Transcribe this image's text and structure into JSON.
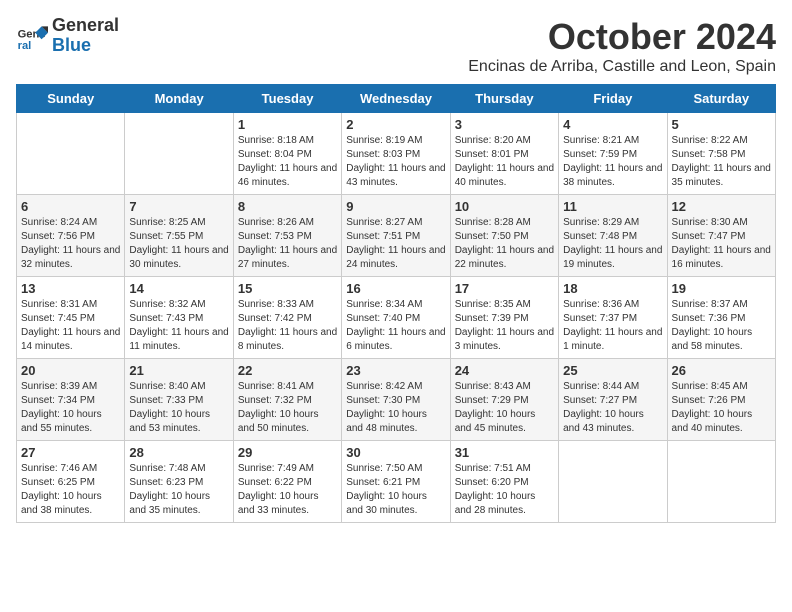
{
  "header": {
    "logo_line1": "General",
    "logo_line2": "Blue",
    "month": "October 2024",
    "location": "Encinas de Arriba, Castille and Leon, Spain"
  },
  "weekdays": [
    "Sunday",
    "Monday",
    "Tuesday",
    "Wednesday",
    "Thursday",
    "Friday",
    "Saturday"
  ],
  "weeks": [
    [
      {
        "day": "",
        "info": ""
      },
      {
        "day": "",
        "info": ""
      },
      {
        "day": "1",
        "info": "Sunrise: 8:18 AM\nSunset: 8:04 PM\nDaylight: 11 hours and 46 minutes."
      },
      {
        "day": "2",
        "info": "Sunrise: 8:19 AM\nSunset: 8:03 PM\nDaylight: 11 hours and 43 minutes."
      },
      {
        "day": "3",
        "info": "Sunrise: 8:20 AM\nSunset: 8:01 PM\nDaylight: 11 hours and 40 minutes."
      },
      {
        "day": "4",
        "info": "Sunrise: 8:21 AM\nSunset: 7:59 PM\nDaylight: 11 hours and 38 minutes."
      },
      {
        "day": "5",
        "info": "Sunrise: 8:22 AM\nSunset: 7:58 PM\nDaylight: 11 hours and 35 minutes."
      }
    ],
    [
      {
        "day": "6",
        "info": "Sunrise: 8:24 AM\nSunset: 7:56 PM\nDaylight: 11 hours and 32 minutes."
      },
      {
        "day": "7",
        "info": "Sunrise: 8:25 AM\nSunset: 7:55 PM\nDaylight: 11 hours and 30 minutes."
      },
      {
        "day": "8",
        "info": "Sunrise: 8:26 AM\nSunset: 7:53 PM\nDaylight: 11 hours and 27 minutes."
      },
      {
        "day": "9",
        "info": "Sunrise: 8:27 AM\nSunset: 7:51 PM\nDaylight: 11 hours and 24 minutes."
      },
      {
        "day": "10",
        "info": "Sunrise: 8:28 AM\nSunset: 7:50 PM\nDaylight: 11 hours and 22 minutes."
      },
      {
        "day": "11",
        "info": "Sunrise: 8:29 AM\nSunset: 7:48 PM\nDaylight: 11 hours and 19 minutes."
      },
      {
        "day": "12",
        "info": "Sunrise: 8:30 AM\nSunset: 7:47 PM\nDaylight: 11 hours and 16 minutes."
      }
    ],
    [
      {
        "day": "13",
        "info": "Sunrise: 8:31 AM\nSunset: 7:45 PM\nDaylight: 11 hours and 14 minutes."
      },
      {
        "day": "14",
        "info": "Sunrise: 8:32 AM\nSunset: 7:43 PM\nDaylight: 11 hours and 11 minutes."
      },
      {
        "day": "15",
        "info": "Sunrise: 8:33 AM\nSunset: 7:42 PM\nDaylight: 11 hours and 8 minutes."
      },
      {
        "day": "16",
        "info": "Sunrise: 8:34 AM\nSunset: 7:40 PM\nDaylight: 11 hours and 6 minutes."
      },
      {
        "day": "17",
        "info": "Sunrise: 8:35 AM\nSunset: 7:39 PM\nDaylight: 11 hours and 3 minutes."
      },
      {
        "day": "18",
        "info": "Sunrise: 8:36 AM\nSunset: 7:37 PM\nDaylight: 11 hours and 1 minute."
      },
      {
        "day": "19",
        "info": "Sunrise: 8:37 AM\nSunset: 7:36 PM\nDaylight: 10 hours and 58 minutes."
      }
    ],
    [
      {
        "day": "20",
        "info": "Sunrise: 8:39 AM\nSunset: 7:34 PM\nDaylight: 10 hours and 55 minutes."
      },
      {
        "day": "21",
        "info": "Sunrise: 8:40 AM\nSunset: 7:33 PM\nDaylight: 10 hours and 53 minutes."
      },
      {
        "day": "22",
        "info": "Sunrise: 8:41 AM\nSunset: 7:32 PM\nDaylight: 10 hours and 50 minutes."
      },
      {
        "day": "23",
        "info": "Sunrise: 8:42 AM\nSunset: 7:30 PM\nDaylight: 10 hours and 48 minutes."
      },
      {
        "day": "24",
        "info": "Sunrise: 8:43 AM\nSunset: 7:29 PM\nDaylight: 10 hours and 45 minutes."
      },
      {
        "day": "25",
        "info": "Sunrise: 8:44 AM\nSunset: 7:27 PM\nDaylight: 10 hours and 43 minutes."
      },
      {
        "day": "26",
        "info": "Sunrise: 8:45 AM\nSunset: 7:26 PM\nDaylight: 10 hours and 40 minutes."
      }
    ],
    [
      {
        "day": "27",
        "info": "Sunrise: 7:46 AM\nSunset: 6:25 PM\nDaylight: 10 hours and 38 minutes."
      },
      {
        "day": "28",
        "info": "Sunrise: 7:48 AM\nSunset: 6:23 PM\nDaylight: 10 hours and 35 minutes."
      },
      {
        "day": "29",
        "info": "Sunrise: 7:49 AM\nSunset: 6:22 PM\nDaylight: 10 hours and 33 minutes."
      },
      {
        "day": "30",
        "info": "Sunrise: 7:50 AM\nSunset: 6:21 PM\nDaylight: 10 hours and 30 minutes."
      },
      {
        "day": "31",
        "info": "Sunrise: 7:51 AM\nSunset: 6:20 PM\nDaylight: 10 hours and 28 minutes."
      },
      {
        "day": "",
        "info": ""
      },
      {
        "day": "",
        "info": ""
      }
    ]
  ]
}
